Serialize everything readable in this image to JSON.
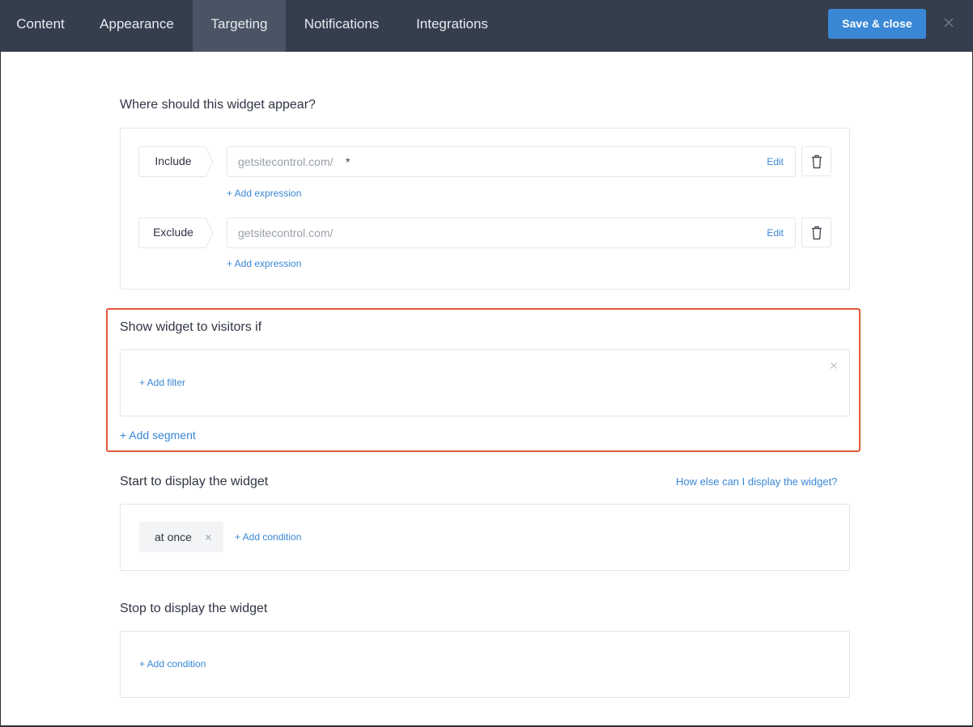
{
  "tabs": [
    {
      "label": "Content",
      "active": false
    },
    {
      "label": "Appearance",
      "active": false
    },
    {
      "label": "Targeting",
      "active": true
    },
    {
      "label": "Notifications",
      "active": false
    },
    {
      "label": "Integrations",
      "active": false
    }
  ],
  "save_button": "Save & close",
  "colors": {
    "topbar": "#353e4d",
    "active_tab": "#4a5464",
    "accent": "#3a87d6",
    "highlight": "#e2573b"
  },
  "where": {
    "title": "Where should this widget appear?",
    "include": {
      "tag": "Include",
      "url": "getsitecontrol.com/",
      "wildcard": "*",
      "edit": "Edit",
      "add": "+ Add expression"
    },
    "exclude": {
      "tag": "Exclude",
      "url": "getsitecontrol.com/",
      "edit": "Edit",
      "add": "+ Add expression"
    }
  },
  "visitors": {
    "title": "Show widget to visitors if",
    "add_filter": "+ Add filter",
    "add_segment": "+ Add segment"
  },
  "start": {
    "title": "Start to display the widget",
    "help_link": "How else can I display the widget?",
    "chip": "at once",
    "add_condition": "+ Add condition"
  },
  "stop": {
    "title": "Stop to display the widget",
    "add_condition": "+ Add condition"
  }
}
